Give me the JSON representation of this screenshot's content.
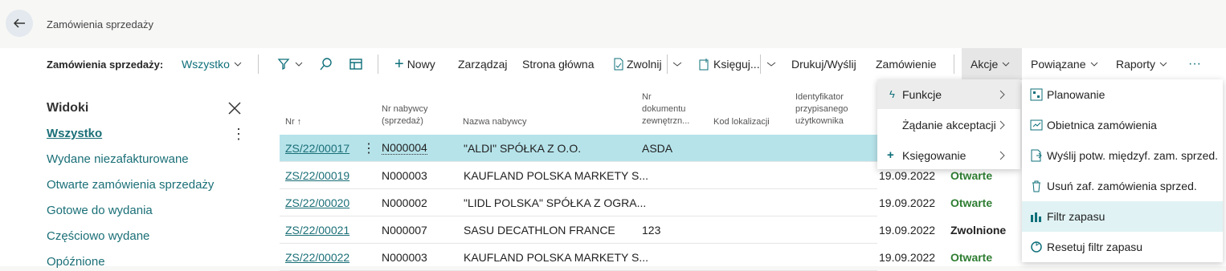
{
  "header": {
    "title": "Zamówienia sprzedaży"
  },
  "toolbar": {
    "view_label": "Zamówienia sprzedaży:",
    "view_value": "Wszystko",
    "new": "Nowy",
    "manage": "Zarządzaj",
    "home": "Strona główna",
    "release": "Zwolnij",
    "post": "Księguj...",
    "print_send": "Drukuj/Wyślij",
    "order": "Zamówienie",
    "actions": "Akcje",
    "related": "Powiązane",
    "reports": "Raporty",
    "more": "···"
  },
  "sidebar": {
    "heading": "Widoki",
    "items": [
      "Wszystko",
      "Wydane niezafakturowane",
      "Otwarte zamówienia sprzedaży",
      "Gotowe do wydania",
      "Częściowo wydane",
      "Opóźnione"
    ]
  },
  "table": {
    "headers": {
      "nr": "Nr",
      "nr_sort": "↑",
      "buyer_no_1": "Nr nabywcy",
      "buyer_no_2": "(sprzedaż)",
      "buyer_name": "Nazwa nabywcy",
      "ext_doc_1": "Nr",
      "ext_doc_2": "dokumentu",
      "ext_doc_3": "zewnętrzn...",
      "location": "Kod lokalizacji",
      "assigned_1": "Identyfikator",
      "assigned_2": "przypisanego",
      "assigned_3": "użytkownika"
    },
    "rows": [
      {
        "nr": "ZS/22/00017",
        "buyer_no": "N000004",
        "name": "\"ALDI\" SPÓŁKA Z O.O.",
        "ext": "ASDA",
        "date": "",
        "status": ""
      },
      {
        "nr": "ZS/22/00019",
        "buyer_no": "N000003",
        "name": "KAUFLAND POLSKA MARKETY S...",
        "ext": "",
        "date": "19.09.2022",
        "status": "Otwarte"
      },
      {
        "nr": "ZS/22/00020",
        "buyer_no": "N000002",
        "name": "\"LIDL POLSKA\" SPÓŁKA Z OGRA...",
        "ext": "",
        "date": "19.09.2022",
        "status": "Otwarte"
      },
      {
        "nr": "ZS/22/00021",
        "buyer_no": "N000007",
        "name": "SASU DECATHLON FRANCE",
        "ext": "123",
        "date": "19.09.2022",
        "status": "Zwolnione"
      },
      {
        "nr": "ZS/22/00022",
        "buyer_no": "N000003",
        "name": "KAUFLAND POLSKA MARKETY S...",
        "ext": "",
        "date": "19.09.2022",
        "status": "Otwarte"
      }
    ]
  },
  "menu_actions": {
    "items": [
      "Funkcje",
      "Żądanie akceptacji",
      "Księgowanie"
    ]
  },
  "menu_functions": {
    "items": [
      {
        "label": "Planowanie",
        "icon": "planning-icon"
      },
      {
        "label": "Obietnica zamówienia",
        "icon": "order-promise-icon"
      },
      {
        "label": "Wyślij potw. międzyf. zam. sprzed.",
        "icon": "send-ic-icon"
      },
      {
        "label": "Usuń zaf. zamówienia sprzed.",
        "icon": "delete-icon"
      },
      {
        "label": "Filtr zapasu",
        "icon": "reservation-filter-icon"
      },
      {
        "label": "Resetuj filtr zapasu",
        "icon": "reset-filter-icon"
      }
    ]
  },
  "colors": {
    "accent": "#0e6f79",
    "selected_row": "#b6e3ea",
    "status_open": "#2e7d32",
    "menu_hover": "#e0f2f4"
  }
}
